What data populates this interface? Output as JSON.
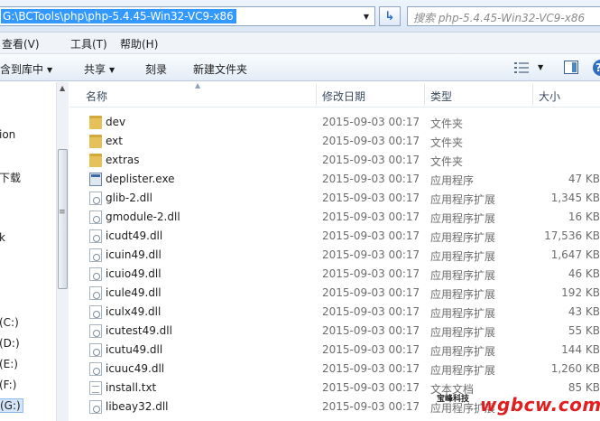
{
  "address_bar": {
    "path": "G:\\BCTools\\php\\php-5.4.45-Win32-VC9-x86",
    "search_placeholder": "搜索 php-5.4.45-Win32-VC9-x86"
  },
  "menu": [
    "查看(V)",
    "工具(T)",
    "帮助(H)"
  ],
  "toolbar": {
    "include_in_library": "含到库中",
    "share": "共享",
    "burn": "刻录",
    "new_folder": "新建文件夹"
  },
  "nav_pane": {
    "items": [
      "ion",
      "下载",
      "k",
      "(C:)",
      "(D:)",
      "(E:)",
      "(F:)",
      "(G:)"
    ]
  },
  "columns": {
    "name": "名称",
    "date": "修改日期",
    "type": "类型",
    "size": "大小"
  },
  "files": [
    {
      "name": "dev",
      "date": "2015-09-03 00:17",
      "type": "文件夹",
      "size": "",
      "icon": "folder-icon"
    },
    {
      "name": "ext",
      "date": "2015-09-03 00:17",
      "type": "文件夹",
      "size": "",
      "icon": "folder-icon"
    },
    {
      "name": "extras",
      "date": "2015-09-03 00:17",
      "type": "文件夹",
      "size": "",
      "icon": "folder-icon"
    },
    {
      "name": "deplister.exe",
      "date": "2015-09-03 00:17",
      "type": "应用程序",
      "size": "47 KB",
      "icon": "exe-icon"
    },
    {
      "name": "glib-2.dll",
      "date": "2015-09-03 00:17",
      "type": "应用程序扩展",
      "size": "1,345 KB",
      "icon": "dll-icon"
    },
    {
      "name": "gmodule-2.dll",
      "date": "2015-09-03 00:17",
      "type": "应用程序扩展",
      "size": "16 KB",
      "icon": "dll-icon"
    },
    {
      "name": "icudt49.dll",
      "date": "2015-09-03 00:17",
      "type": "应用程序扩展",
      "size": "17,536 KB",
      "icon": "dll-icon"
    },
    {
      "name": "icuin49.dll",
      "date": "2015-09-03 00:17",
      "type": "应用程序扩展",
      "size": "1,647 KB",
      "icon": "dll-icon"
    },
    {
      "name": "icuio49.dll",
      "date": "2015-09-03 00:17",
      "type": "应用程序扩展",
      "size": "46 KB",
      "icon": "dll-icon"
    },
    {
      "name": "icule49.dll",
      "date": "2015-09-03 00:17",
      "type": "应用程序扩展",
      "size": "192 KB",
      "icon": "dll-icon"
    },
    {
      "name": "iculx49.dll",
      "date": "2015-09-03 00:17",
      "type": "应用程序扩展",
      "size": "43 KB",
      "icon": "dll-icon"
    },
    {
      "name": "icutest49.dll",
      "date": "2015-09-03 00:17",
      "type": "应用程序扩展",
      "size": "55 KB",
      "icon": "dll-icon"
    },
    {
      "name": "icutu49.dll",
      "date": "2015-09-03 00:17",
      "type": "应用程序扩展",
      "size": "144 KB",
      "icon": "dll-icon"
    },
    {
      "name": "icuuc49.dll",
      "date": "2015-09-03 00:17",
      "type": "应用程序扩展",
      "size": "1,260 KB",
      "icon": "dll-icon"
    },
    {
      "name": "install.txt",
      "date": "2015-09-03 00:17",
      "type": "文本文档",
      "size": "85 KB",
      "icon": "txt-icon"
    },
    {
      "name": "libeay32.dll",
      "date": "2015-09-03 00:17",
      "type": "应用程序扩展",
      "size": "",
      "icon": "dll-icon"
    }
  ],
  "watermark": {
    "brand": "wgbcw.com",
    "small": "宝峰科技"
  }
}
